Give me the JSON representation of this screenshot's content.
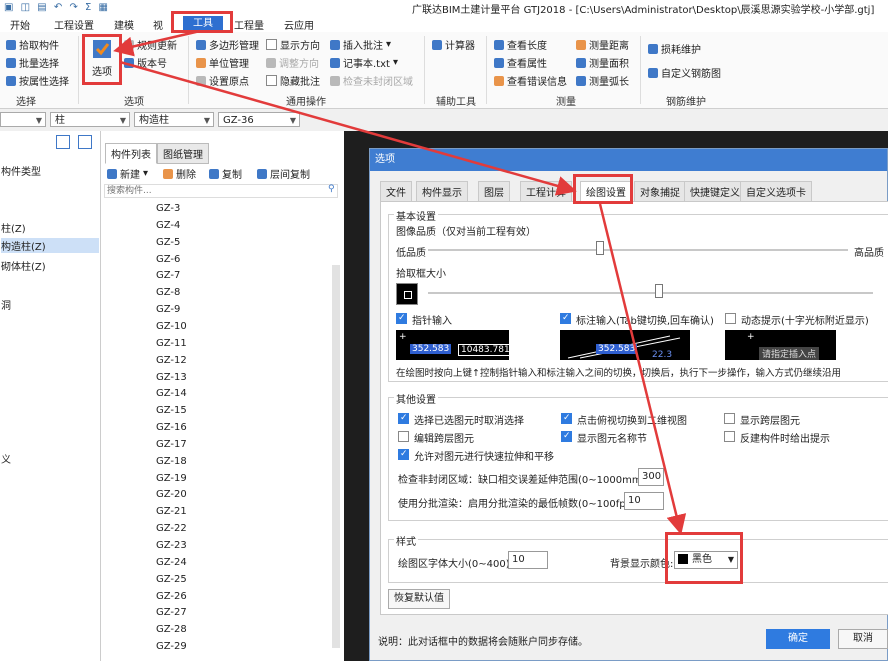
{
  "window": {
    "title": "广联达BIM土建计量平台 GTJ2018 - [C:\\Users\\Administrator\\Desktop\\辰溪思源实验学校-小学部.gtj]"
  },
  "ribbon_tabs": [
    "开始",
    "工程设置",
    "建模",
    "视",
    "工具",
    "工程量",
    "云应用"
  ],
  "ribbon": {
    "select_group": {
      "items": [
        "拾取构件",
        "批量选择",
        "按属性选择"
      ],
      "label": "选择"
    },
    "options_group": {
      "big_button": "选项",
      "items": [
        "规则更新",
        "版本号"
      ],
      "label": "选项"
    },
    "general_group": {
      "col1": [
        "多边形管理",
        "单位管理",
        "设置原点"
      ],
      "col2": [
        "显示方向",
        "调整方向",
        "隐藏批注"
      ],
      "col3": [
        "插入批注",
        "记事本.txt",
        "检查未封闭区域"
      ],
      "label": "通用操作"
    },
    "aux_group": {
      "items": [
        "计算器"
      ],
      "label": "辅助工具"
    },
    "measure_group": {
      "col1": [
        "查看长度",
        "查看属性",
        "查看错误信息"
      ],
      "col2": [
        "测量距离",
        "测量面积",
        "测量弧长"
      ],
      "label": "测量"
    },
    "rebar_group": {
      "items": [
        "损耗维护",
        "自定义钢筋图"
      ],
      "label": "钢筋维护"
    }
  },
  "toolbar_combos": [
    "",
    "柱",
    "构造柱",
    "GZ-36"
  ],
  "left_tree": [
    "构件类型",
    "柱(Z)",
    "构造柱(Z)",
    "砌体柱(Z)",
    "洞",
    "义"
  ],
  "left_tree_selected": "构造柱(Z)",
  "list_panel": {
    "tabs": [
      "构件列表",
      "图纸管理"
    ],
    "actions": [
      "新建",
      "删除",
      "复制",
      "层间复制"
    ],
    "search_placeholder": "搜索构件...",
    "items": [
      "GZ-3",
      "GZ-4",
      "GZ-5",
      "GZ-6",
      "GZ-7",
      "GZ-8",
      "GZ-9",
      "GZ-10",
      "GZ-11",
      "GZ-12",
      "GZ-13",
      "GZ-14",
      "GZ-15",
      "GZ-16",
      "GZ-17",
      "GZ-18",
      "GZ-19",
      "GZ-20",
      "GZ-21",
      "GZ-22",
      "GZ-23",
      "GZ-24",
      "GZ-25",
      "GZ-26",
      "GZ-27",
      "GZ-28",
      "GZ-29"
    ]
  },
  "dialog": {
    "title": "选项",
    "tabs": [
      "文件",
      "构件显示",
      "图层",
      "工程计算",
      "绘图设置",
      "对象捕捉",
      "快捷键定义",
      "自定义选项卡"
    ],
    "active_tab": "绘图设置",
    "basic": {
      "legend": "基本设置",
      "quality_label": "图像品质（仅对当前工程有效）",
      "quality_low": "低品质",
      "quality_high": "高品质",
      "quality_value": 0.41,
      "pick_size_label": "拾取框大小",
      "pick_size_value": 0.52,
      "pointer_input": {
        "label": "指针输入",
        "checked": true,
        "preview_a": "352.583",
        "preview_b": "10483.781"
      },
      "dimension_input": {
        "label": "标注输入(Tab键切换,回车确认)",
        "checked": true,
        "preview_a": "352.583",
        "preview_b": "22.3"
      },
      "dynamic_hint": {
        "label": "动态提示(十字光标附近显示)",
        "checked": false,
        "preview": "请指定插入点"
      },
      "note": "在绘图时按向上键↑控制指针输入和标注输入之间的切换，切换后，执行下一步操作，输入方式仍继续沿用"
    },
    "other": {
      "legend": "其他设置",
      "checks": [
        {
          "label": "选择已选图元时取消选择",
          "checked": true
        },
        {
          "label": "点击俯视切换到二维视图",
          "checked": true
        },
        {
          "label": "显示跨层图元",
          "checked": false
        },
        {
          "label": "编辑跨层图元",
          "checked": false
        },
        {
          "label": "显示图元名称节",
          "checked": true
        },
        {
          "label": "反建构件时给出提示",
          "checked": false
        },
        {
          "label": "允许对图元进行快速拉伸和平移",
          "checked": true
        }
      ],
      "gap_label": "检查非封闭区域：缺口相交误差延伸范围(0~1000mm):",
      "gap_value": "300",
      "render_label": "使用分批渲染：启用分批渲染的最低帧数(0~100fps):",
      "render_value": "10"
    },
    "style": {
      "legend": "样式",
      "font_label": "绘图区字体大小(0~400):",
      "font_value": "10",
      "bg_label": "背景显示颜色:",
      "bg_value": "黑色",
      "bg_swatch": "#000000"
    },
    "restore_button": "恢复默认值",
    "footer_note": "说明：此对话框中的数据将会随账户同步存储。",
    "ok_button": "确定",
    "cancel_button": "取消"
  },
  "colors": {
    "accent": "#2e6fd0",
    "highlight": "#e23b3b",
    "drawing_bg": "#1e1e1e"
  }
}
